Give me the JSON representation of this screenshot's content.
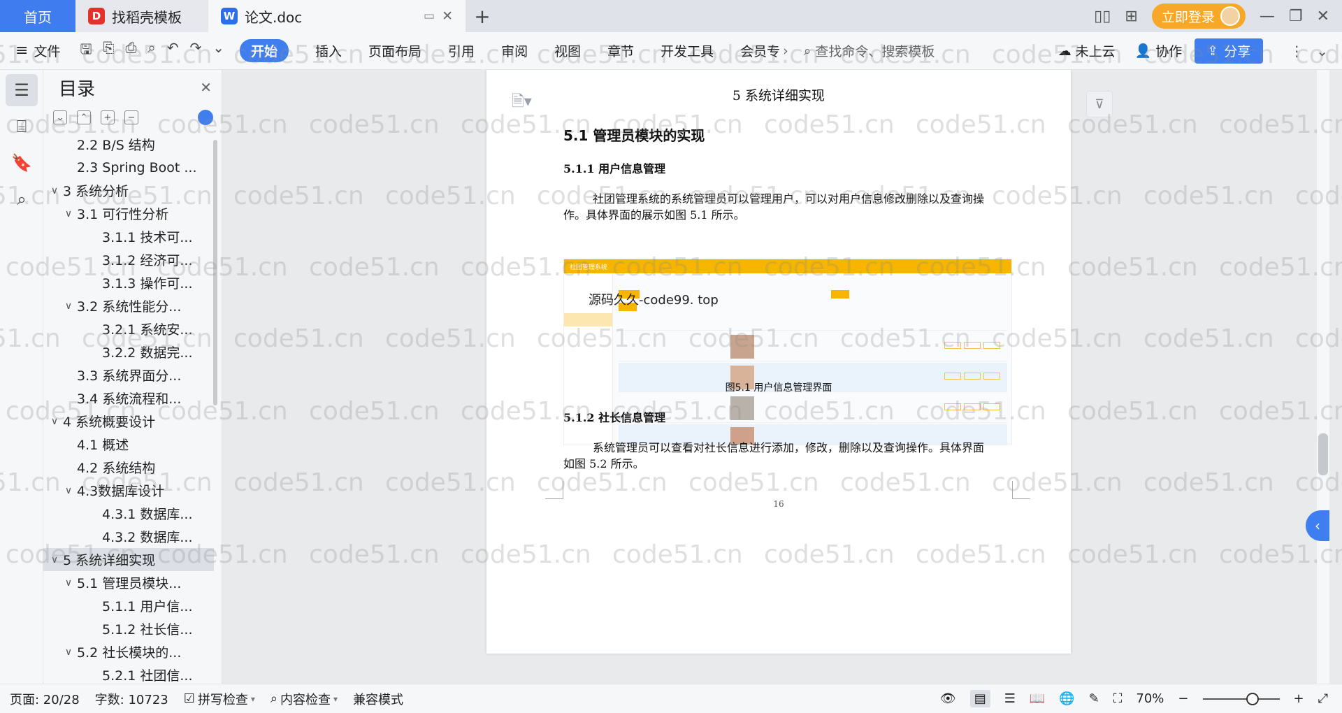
{
  "titlebar": {
    "tabs": [
      {
        "label": "首页"
      },
      {
        "label": "找稻壳模板"
      },
      {
        "label": "论文.doc"
      }
    ],
    "login_label": "立即登录"
  },
  "toolbar": {
    "file_label": "文件",
    "start_label": "开始",
    "menu": [
      "插入",
      "页面布局",
      "引用",
      "审阅",
      "视图",
      "章节",
      "开发工具",
      "会员专"
    ],
    "search_placeholder": "查找命令、搜索模板",
    "cloud_label": "未上云",
    "collab_label": "协作",
    "share_label": "分享"
  },
  "toc": {
    "title": "目录",
    "items": [
      {
        "label": "2.2 B/S 结构",
        "level": 2,
        "arrow": ""
      },
      {
        "label": "2.3 Spring Boot ...",
        "level": 2,
        "arrow": ""
      },
      {
        "label": "3 系统分析",
        "level": 1,
        "arrow": "∨"
      },
      {
        "label": "3.1 可行性分析",
        "level": 2,
        "arrow": "∨"
      },
      {
        "label": "3.1.1 技术可...",
        "level": 3,
        "arrow": ""
      },
      {
        "label": "3.1.2 经济可...",
        "level": 3,
        "arrow": ""
      },
      {
        "label": "3.1.3 操作可...",
        "level": 3,
        "arrow": ""
      },
      {
        "label": "3.2 系统性能分...",
        "level": 2,
        "arrow": "∨"
      },
      {
        "label": "3.2.1 系统安...",
        "level": 3,
        "arrow": ""
      },
      {
        "label": "3.2.2 数据完...",
        "level": 3,
        "arrow": ""
      },
      {
        "label": "3.3 系统界面分...",
        "level": 2,
        "arrow": ""
      },
      {
        "label": "3.4 系统流程和...",
        "level": 2,
        "arrow": ""
      },
      {
        "label": "4 系统概要设计",
        "level": 1,
        "arrow": "∨"
      },
      {
        "label": "4.1 概述",
        "level": 2,
        "arrow": ""
      },
      {
        "label": "4.2 系统结构",
        "level": 2,
        "arrow": ""
      },
      {
        "label": "4.3数据库设计",
        "level": 2,
        "arrow": "∨"
      },
      {
        "label": "4.3.1 数据库...",
        "level": 3,
        "arrow": ""
      },
      {
        "label": "4.3.2 数据库...",
        "level": 3,
        "arrow": ""
      },
      {
        "label": "5 系统详细实现",
        "level": 1,
        "arrow": "∨",
        "selected": true
      },
      {
        "label": "5.1 管理员模块...",
        "level": 2,
        "arrow": "∨"
      },
      {
        "label": "5.1.1 用户信...",
        "level": 3,
        "arrow": ""
      },
      {
        "label": "5.1.2 社长信...",
        "level": 3,
        "arrow": ""
      },
      {
        "label": "5.2 社长模块的...",
        "level": 2,
        "arrow": "∨"
      },
      {
        "label": "5.2.1 社团信...",
        "level": 3,
        "arrow": ""
      }
    ]
  },
  "document": {
    "header": "5 系统详细实现",
    "h2": "5.1  管理员模块的实现",
    "h3a": "5.1.1  用户信息管理",
    "para1_l1": "社团管理系统的系统管理员可以管理用户，可以对用户信息修改删除以及查询操",
    "para1_l2": "作。具体界面的展示如图 5.1 所示。",
    "figure_app_title": "社团管理系统",
    "figure_overlay": "源码久久-code99. top",
    "caption": "图5.1  用户信息管理界面",
    "h3b": "5.1.2  社长信息管理",
    "para2_l1": "系统管理员可以查看对社长信息进行添加，修改，删除以及查询操作。具体界面",
    "para2_l2": "如图 5.2 所示。",
    "page_number": "16"
  },
  "watermark": "code51.cn",
  "status": {
    "page": "页面: 20/28",
    "words": "字数: 10723",
    "spell": "拼写检查",
    "content": "内容检查",
    "compat": "兼容模式",
    "zoom": "70%"
  },
  "colors": {
    "accent": "#3e7ef0",
    "login": "#f7a829",
    "figure_bar": "#f7b500"
  }
}
